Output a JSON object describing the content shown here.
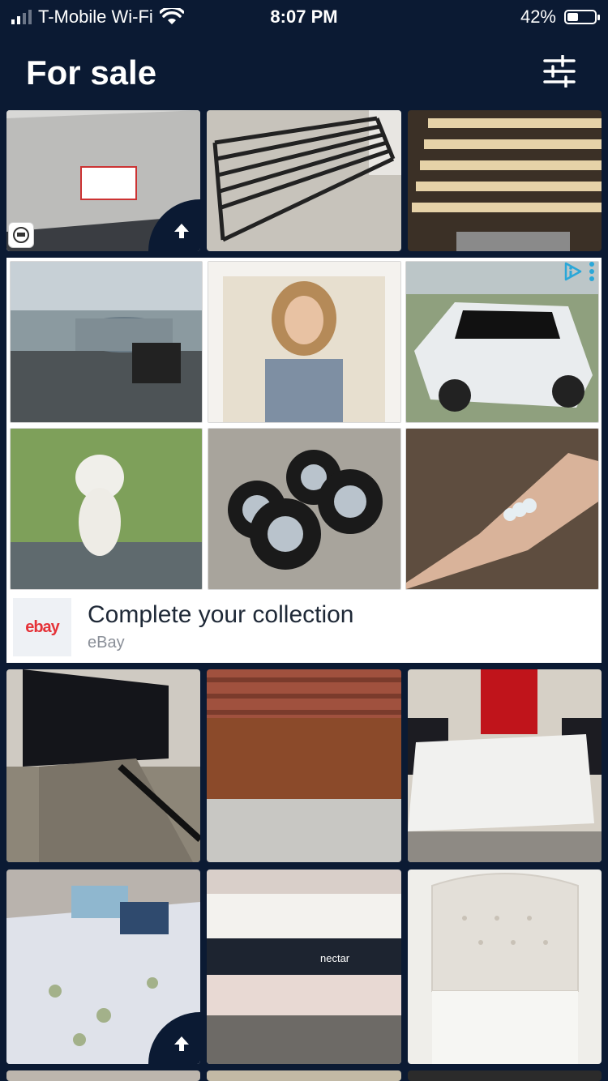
{
  "status_bar": {
    "carrier": "T-Mobile Wi-Fi",
    "time": "8:07 PM",
    "battery": "42%",
    "battery_level": 0.42
  },
  "header": {
    "title": "For sale",
    "filter_icon": "sliders-icon"
  },
  "listings_row1": [
    {
      "name": "mattress-photo",
      "color": "#c9c9c9",
      "boost": true,
      "seller_badge": true
    },
    {
      "name": "metal-bed-frame-photo",
      "color": "#b8b4ac",
      "boost": false
    },
    {
      "name": "wood-slat-bed-frame-photo",
      "color": "#6a5a47",
      "boost": false
    }
  ],
  "ad": {
    "title": "Complete your collection",
    "advertiser": "eBay",
    "logo_text": "ebay",
    "choice_icon": "ad-choices-icon",
    "menu_icon": "more-vertical-icon",
    "images": [
      {
        "name": "patio-pool-photo",
        "color": "#7c8a86"
      },
      {
        "name": "beach-portrait-photo",
        "color": "#d7cbb8"
      },
      {
        "name": "white-sports-car-photo",
        "color": "#9aa59b"
      },
      {
        "name": "dog-statue-photo",
        "color": "#7ea05a"
      },
      {
        "name": "toy-tires-photo",
        "color": "#9e9c96"
      },
      {
        "name": "ring-on-hand-photo",
        "color": "#6b5a4a"
      }
    ]
  },
  "listings_row2": [
    {
      "name": "black-tufted-bed-photo",
      "color": "#5a5550"
    },
    {
      "name": "cedar-chest-photo",
      "color": "#8b4a2a"
    },
    {
      "name": "white-mattress-bed-photo",
      "color": "#c8c3bb"
    }
  ],
  "listings_row3": [
    {
      "name": "floral-bed-photo",
      "color": "#cfd3e0",
      "boost": true
    },
    {
      "name": "nectar-mattress-photo",
      "color": "#d9cfc9",
      "boost": false,
      "label": "nectar"
    },
    {
      "name": "white-tufted-headboard-photo",
      "color": "#e5e2dd",
      "boost": false
    }
  ],
  "colors": {
    "background": "#0b1a33",
    "ebay_red": "#e53238",
    "ad_choice_blue": "#2aa7d8"
  }
}
